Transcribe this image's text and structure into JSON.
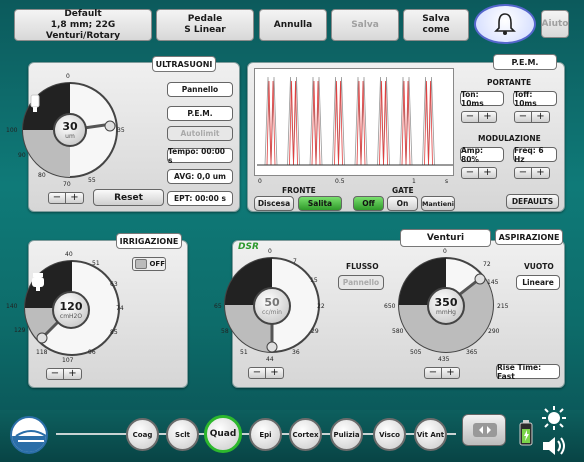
{
  "top_bar": {
    "settings": {
      "line1": "Default",
      "line2": "1,8 mm; 22G Venturi/Rotary"
    },
    "pedal": {
      "line1": "Pedale",
      "line2": "S Linear"
    },
    "annulla": "Annulla",
    "salva": "Salva",
    "salva_come": {
      "line1": "Salva",
      "line2": "come"
    },
    "aiuto": "Aiuto"
  },
  "ultrasuoni": {
    "title": "ULTRASUONI",
    "value": "30",
    "unit": "um",
    "ticks": [
      "0",
      "35",
      "35",
      "55",
      "70",
      "80",
      "90",
      "100"
    ],
    "pannello": "Pannello",
    "pem": "P.E.M.",
    "autolimit": "Autolimit",
    "tempo": "Tempo: 00:00 s",
    "avg": "AVG: 0,0 um",
    "ept": "EPT: 00:00 s",
    "reset": "Reset",
    "level": 0.3
  },
  "pem": {
    "title": "P.E.M.",
    "portante_label": "PORTANTE",
    "ton": "Ton: 10ms",
    "toff": "Toff: 10ms",
    "modulazione_label": "MODULAZIONE",
    "amp": "Amp: 80%",
    "freq": "Freq: 6 Hz",
    "defaults": "DEFAULTS",
    "x_ticks": [
      "0",
      "0.5",
      "1",
      "s"
    ],
    "fronte_label": "FRONTE",
    "discesa": "Discesa",
    "salita": "Salita",
    "gate_label": "GATE",
    "off": "Off",
    "on": "On",
    "mantieni": "Mantieni",
    "pulse_count": 8
  },
  "irrigazione": {
    "title": "IRRIGAZIONE",
    "toggle": "OFF",
    "value": "120",
    "unit": "cmH2O",
    "ticks": [
      "40",
      "51",
      "63",
      "74",
      "85",
      "96",
      "107",
      "118",
      "129",
      "140"
    ]
  },
  "dsr": {
    "logo": "DSR",
    "venturi": "Venturi",
    "aspirazione": "ASPIRAZIONE",
    "flusso_label": "FLUSSO",
    "pannello": "Pannello",
    "flow_value": "50",
    "flow_unit": "cc/min",
    "flow_ticks": [
      "0",
      "7",
      "15",
      "22",
      "29",
      "36",
      "44",
      "51",
      "58",
      "65"
    ],
    "vuoto_label": "VUOTO",
    "lineare": "Lineare",
    "vac_value": "350",
    "vac_unit": "mmHg",
    "vac_ticks": [
      "0",
      "72",
      "145",
      "215",
      "290",
      "365",
      "435",
      "505",
      "580",
      "650"
    ],
    "rise_time": "Rise Time: Fast"
  },
  "modes": [
    "Coag",
    "Sclt",
    "Quad",
    "Epi",
    "Cortex",
    "Pulizia",
    "Visco",
    "Vit Ant"
  ],
  "active_mode": "Quad",
  "colors": {
    "accent_green": "#2db82d",
    "background": "#0f7a78",
    "dark_sector": "#222222"
  }
}
